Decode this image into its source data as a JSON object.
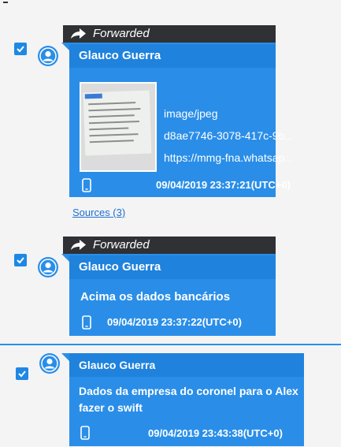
{
  "messages": [
    {
      "forwarded_label": "Forwarded",
      "sender": "Glauco Guerra",
      "attachment": {
        "mime": "image/jpeg",
        "id": "d8ae7746-3078-417c-9b...",
        "url": "https://mmg-fna.whatsap..."
      },
      "timestamp": "09/04/2019 23:37:21(UTC+0)",
      "sources_link": "Sources (3)"
    },
    {
      "forwarded_label": "Forwarded",
      "sender": "Glauco Guerra",
      "text": "Acima os dados bancários",
      "timestamp": "09/04/2019 23:37:22(UTC+0)"
    },
    {
      "sender": "Glauco Guerra",
      "text": "Dados da empresa do coronel para o Alex fazer o swift",
      "timestamp": "09/04/2019 23:43:38(UTC+0)"
    }
  ],
  "icons": {
    "checkbox": "checkbox-checked-icon",
    "avatar": "user-avatar-icon",
    "forward": "forward-arrow-icon",
    "device": "phone-icon"
  },
  "colors": {
    "bubble": "#2a8ee8",
    "sender_bar": "#1f82dc",
    "forward_bar": "#2f3135",
    "link": "#1f6fd1",
    "background": "#f4f4f4"
  }
}
